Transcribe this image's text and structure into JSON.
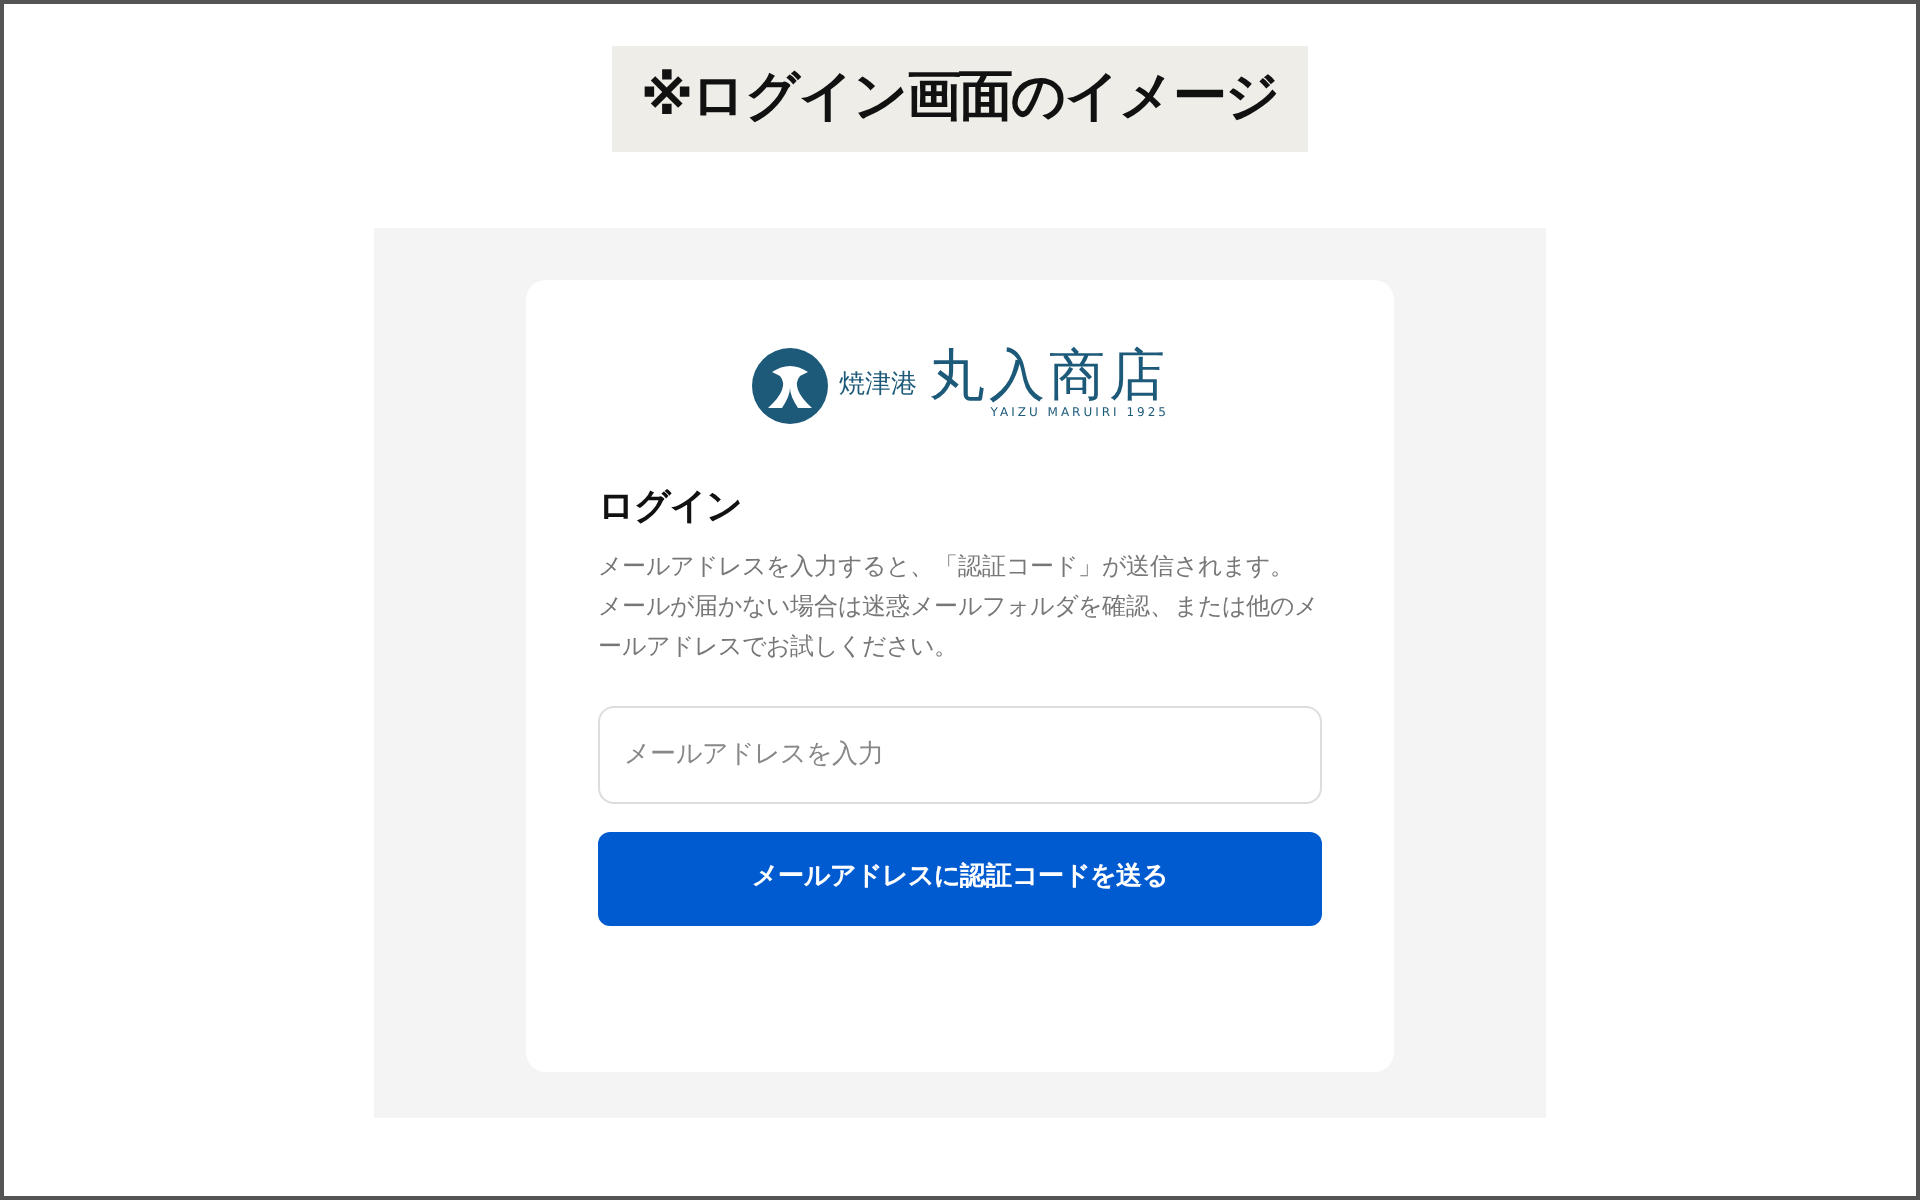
{
  "caption": "※ログイン画面のイメージ",
  "logo": {
    "place": "焼津港",
    "name": "丸入商店",
    "tagline": "YAIZU MARUIRI 1925"
  },
  "heading": "ログイン",
  "description": [
    "メールアドレスを入力すると、「認証コード」が送信されます。",
    "メールが届かない場合は迷惑メールフォルダを確認、または他のメールアドレスでお試しください。"
  ],
  "email_field": {
    "placeholder": "メールアドレスを入力"
  },
  "submit_button": "メールアドレスに認証コードを送る"
}
